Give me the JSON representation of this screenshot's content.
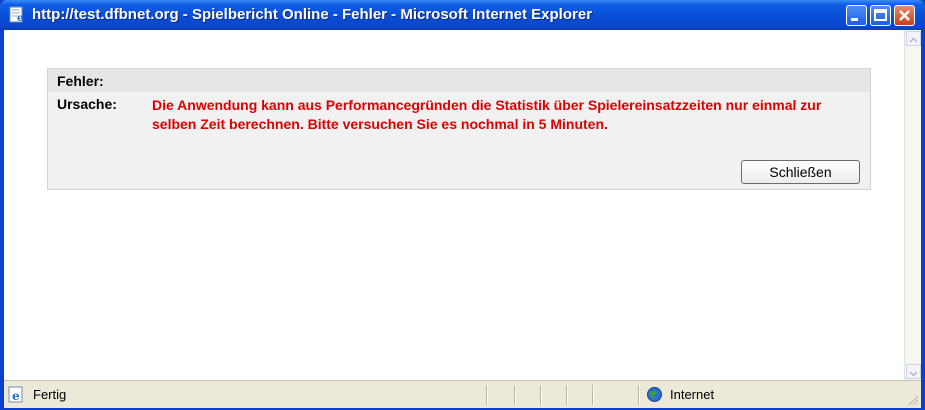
{
  "window": {
    "title": "http://test.dfbnet.org - Spielbericht Online - Fehler - Microsoft Internet Explorer"
  },
  "error": {
    "label_fehler": "Fehler:",
    "label_ursache": "Ursache:",
    "message": "Die Anwendung kann aus Performancegründen die Statistik über Spielereinsatzzeiten nur einmal zur selben Zeit berechnen. Bitte versuchen Sie es nochmal in 5 Minuten.",
    "close_button": "Schließen"
  },
  "statusbar": {
    "status_text": "Fertig",
    "zone_text": "Internet"
  },
  "colors": {
    "titlebar": "#0a4fd8",
    "error_text": "#e00000"
  },
  "icons": [
    "ie-page-icon",
    "minimize-icon",
    "maximize-icon",
    "close-icon",
    "scroll-up-icon",
    "scroll-down-icon",
    "ie-status-icon",
    "internet-globe-icon",
    "resize-grip-icon"
  ]
}
